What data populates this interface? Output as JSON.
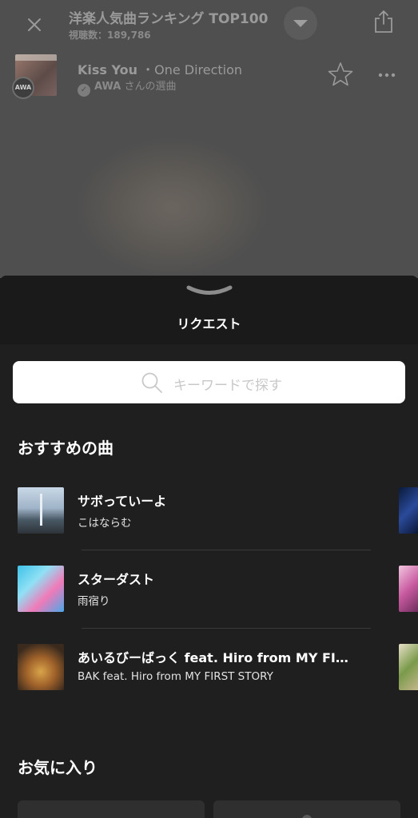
{
  "player": {
    "playlist_title": "洋楽人気曲ランキング TOP100",
    "views": "視聴数：189,786",
    "track_title": "Kiss You",
    "separator": "・",
    "track_artist": "One Direction",
    "badge": "AWA",
    "curator_name": "AWA",
    "curator_suffix": "さんの選曲"
  },
  "sheet": {
    "title": "リクエスト",
    "search_placeholder": "キーワードで探す"
  },
  "recommended": {
    "heading": "おすすめの曲",
    "songs": [
      {
        "title": "サボっていーよ",
        "artist": "こはならむ"
      },
      {
        "title": "スターダスト",
        "artist": "雨宿り"
      },
      {
        "title": "あいるびーばっく feat. Hiro from MY FIRST STORY",
        "artist": "BAK feat. Hiro from MY FIRST STORY"
      }
    ]
  },
  "favorites": {
    "heading": "お気に入り"
  },
  "colors": {
    "sheet_bg": "#1f1f1f",
    "header_bg": "#1a1a1a",
    "dim_bg": "#4f4f4f"
  }
}
